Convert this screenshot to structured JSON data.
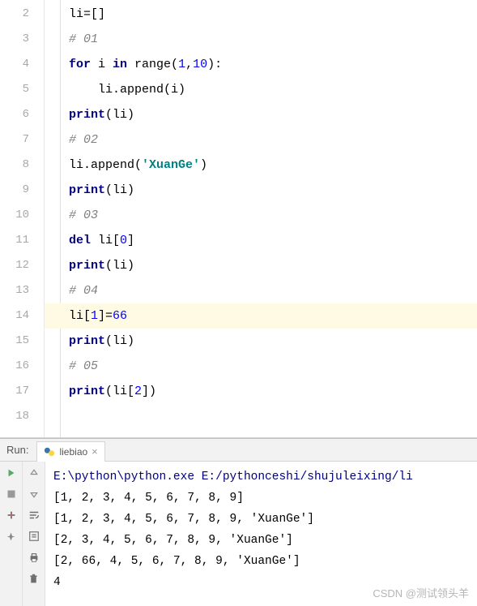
{
  "gutter": [
    "2",
    "3",
    "4",
    "5",
    "6",
    "7",
    "8",
    "9",
    "10",
    "11",
    "12",
    "13",
    "14",
    "15",
    "16",
    "17",
    "18"
  ],
  "code": {
    "l2_a": "li=[]",
    "l3_a": "# 01",
    "l4_a": "for",
    "l4_b": " i ",
    "l4_c": "in",
    "l4_d": " range(",
    "l4_e": "1",
    "l4_f": ",",
    "l4_g": "10",
    "l4_h": "):",
    "l5_a": "    li.append(i)",
    "l6_a": "print",
    "l6_b": "(li)",
    "l7_a": "# 02",
    "l8_a": "li.append(",
    "l8_b": "'XuanGe'",
    "l8_c": ")",
    "l9_a": "print",
    "l9_b": "(li)",
    "l10_a": "# 03",
    "l11_a": "del",
    "l11_b": " li[",
    "l11_c": "0",
    "l11_d": "]",
    "l12_a": "print",
    "l12_b": "(li)",
    "l13_a": "# 04",
    "l14_a": "li[",
    "l14_b": "1",
    "l14_c": "]=",
    "l14_d": "66",
    "l15_a": "print",
    "l15_b": "(li)",
    "l16_a": "# 05",
    "l17_a": "print",
    "l17_b": "(li[",
    "l17_c": "2",
    "l17_d": "])"
  },
  "run": {
    "label": "Run:",
    "tab_name": "liebiao",
    "output": [
      "E:\\python\\python.exe E:/pythonceshi/shujuleixing/li",
      "[1, 2, 3, 4, 5, 6, 7, 8, 9]",
      "[1, 2, 3, 4, 5, 6, 7, 8, 9, 'XuanGe']",
      "[2, 3, 4, 5, 6, 7, 8, 9, 'XuanGe']",
      "[2, 66, 4, 5, 6, 7, 8, 9, 'XuanGe']",
      "4"
    ]
  },
  "watermark": "CSDN @测试领头羊"
}
